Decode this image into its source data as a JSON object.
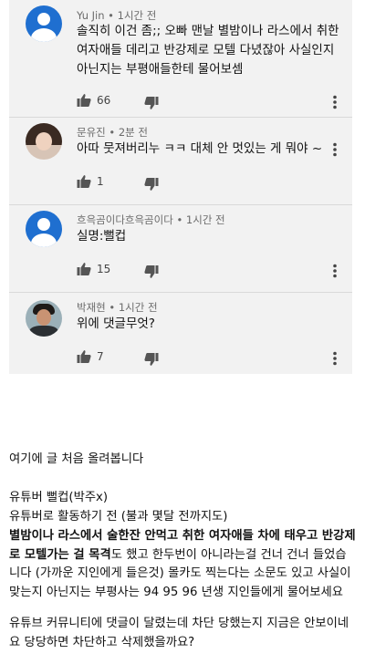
{
  "comments": [
    {
      "author": "Yu Jin",
      "separator": " • ",
      "time": "1시간 전",
      "text": "솔직히 이건 좀;; 오빠 맨날 별밤이나 라스에서 취한 여자애들 데리고 반강제로 모텔 다녔잖아 사실인지 아닌지는 부평애들한테 물어보셈",
      "likes": "66",
      "avatar_icon": "default-avatar-icon"
    },
    {
      "author": "문유진",
      "separator": " • ",
      "time": "2분 전",
      "text": "아따 뭇져버리누 ㅋㅋ 대체 안 멋있는 게 뭐야 ~",
      "likes": "1",
      "avatar_icon": "profile-photo-avatar"
    },
    {
      "author": "흐윽곰이다흐윽곰이다",
      "separator": " • ",
      "time": "1시간 전",
      "text": "실명:뻘컵",
      "likes": "15",
      "avatar_icon": "default-avatar-icon"
    },
    {
      "author": "박재현",
      "separator": " • ",
      "time": "1시간 전",
      "text": "위에 댓글무엇?",
      "likes": "7",
      "avatar_icon": "profile-photo-avatar"
    }
  ],
  "article": {
    "intro": "여기에 글 처음 올려봅니다",
    "line1": "유튜버 뻘컵(박주x)",
    "line2": "유튜버로 활동하기 전 (불과 몇달 전까지도)",
    "bold_part": "별밤이나 라스에서 술한잔 안먹고 취한 여자애들 차에 태우고 반강제로 모텔가는 걸 목격",
    "rest_part": "도 했고 한두번이 아니라는걸 건너 건너 들었습니다 (가까운 지인에게 들은것) 몰카도 찍는다는 소문도 있고 사실이 맞는지 아닌지는 부평사는 94 95 96 년생 지인들에게 물어보세요",
    "closing": "유튜브 커뮤니티에 댓글이 달렸는데 차단 당했는지 지금은 안보이네요 당당하면 차단하고 삭제했을까요?"
  },
  "colors": {
    "avatar_blue": "#1f6fd0",
    "comment_bg": "#f2f2f2",
    "meta_text": "#6b6b6b"
  }
}
